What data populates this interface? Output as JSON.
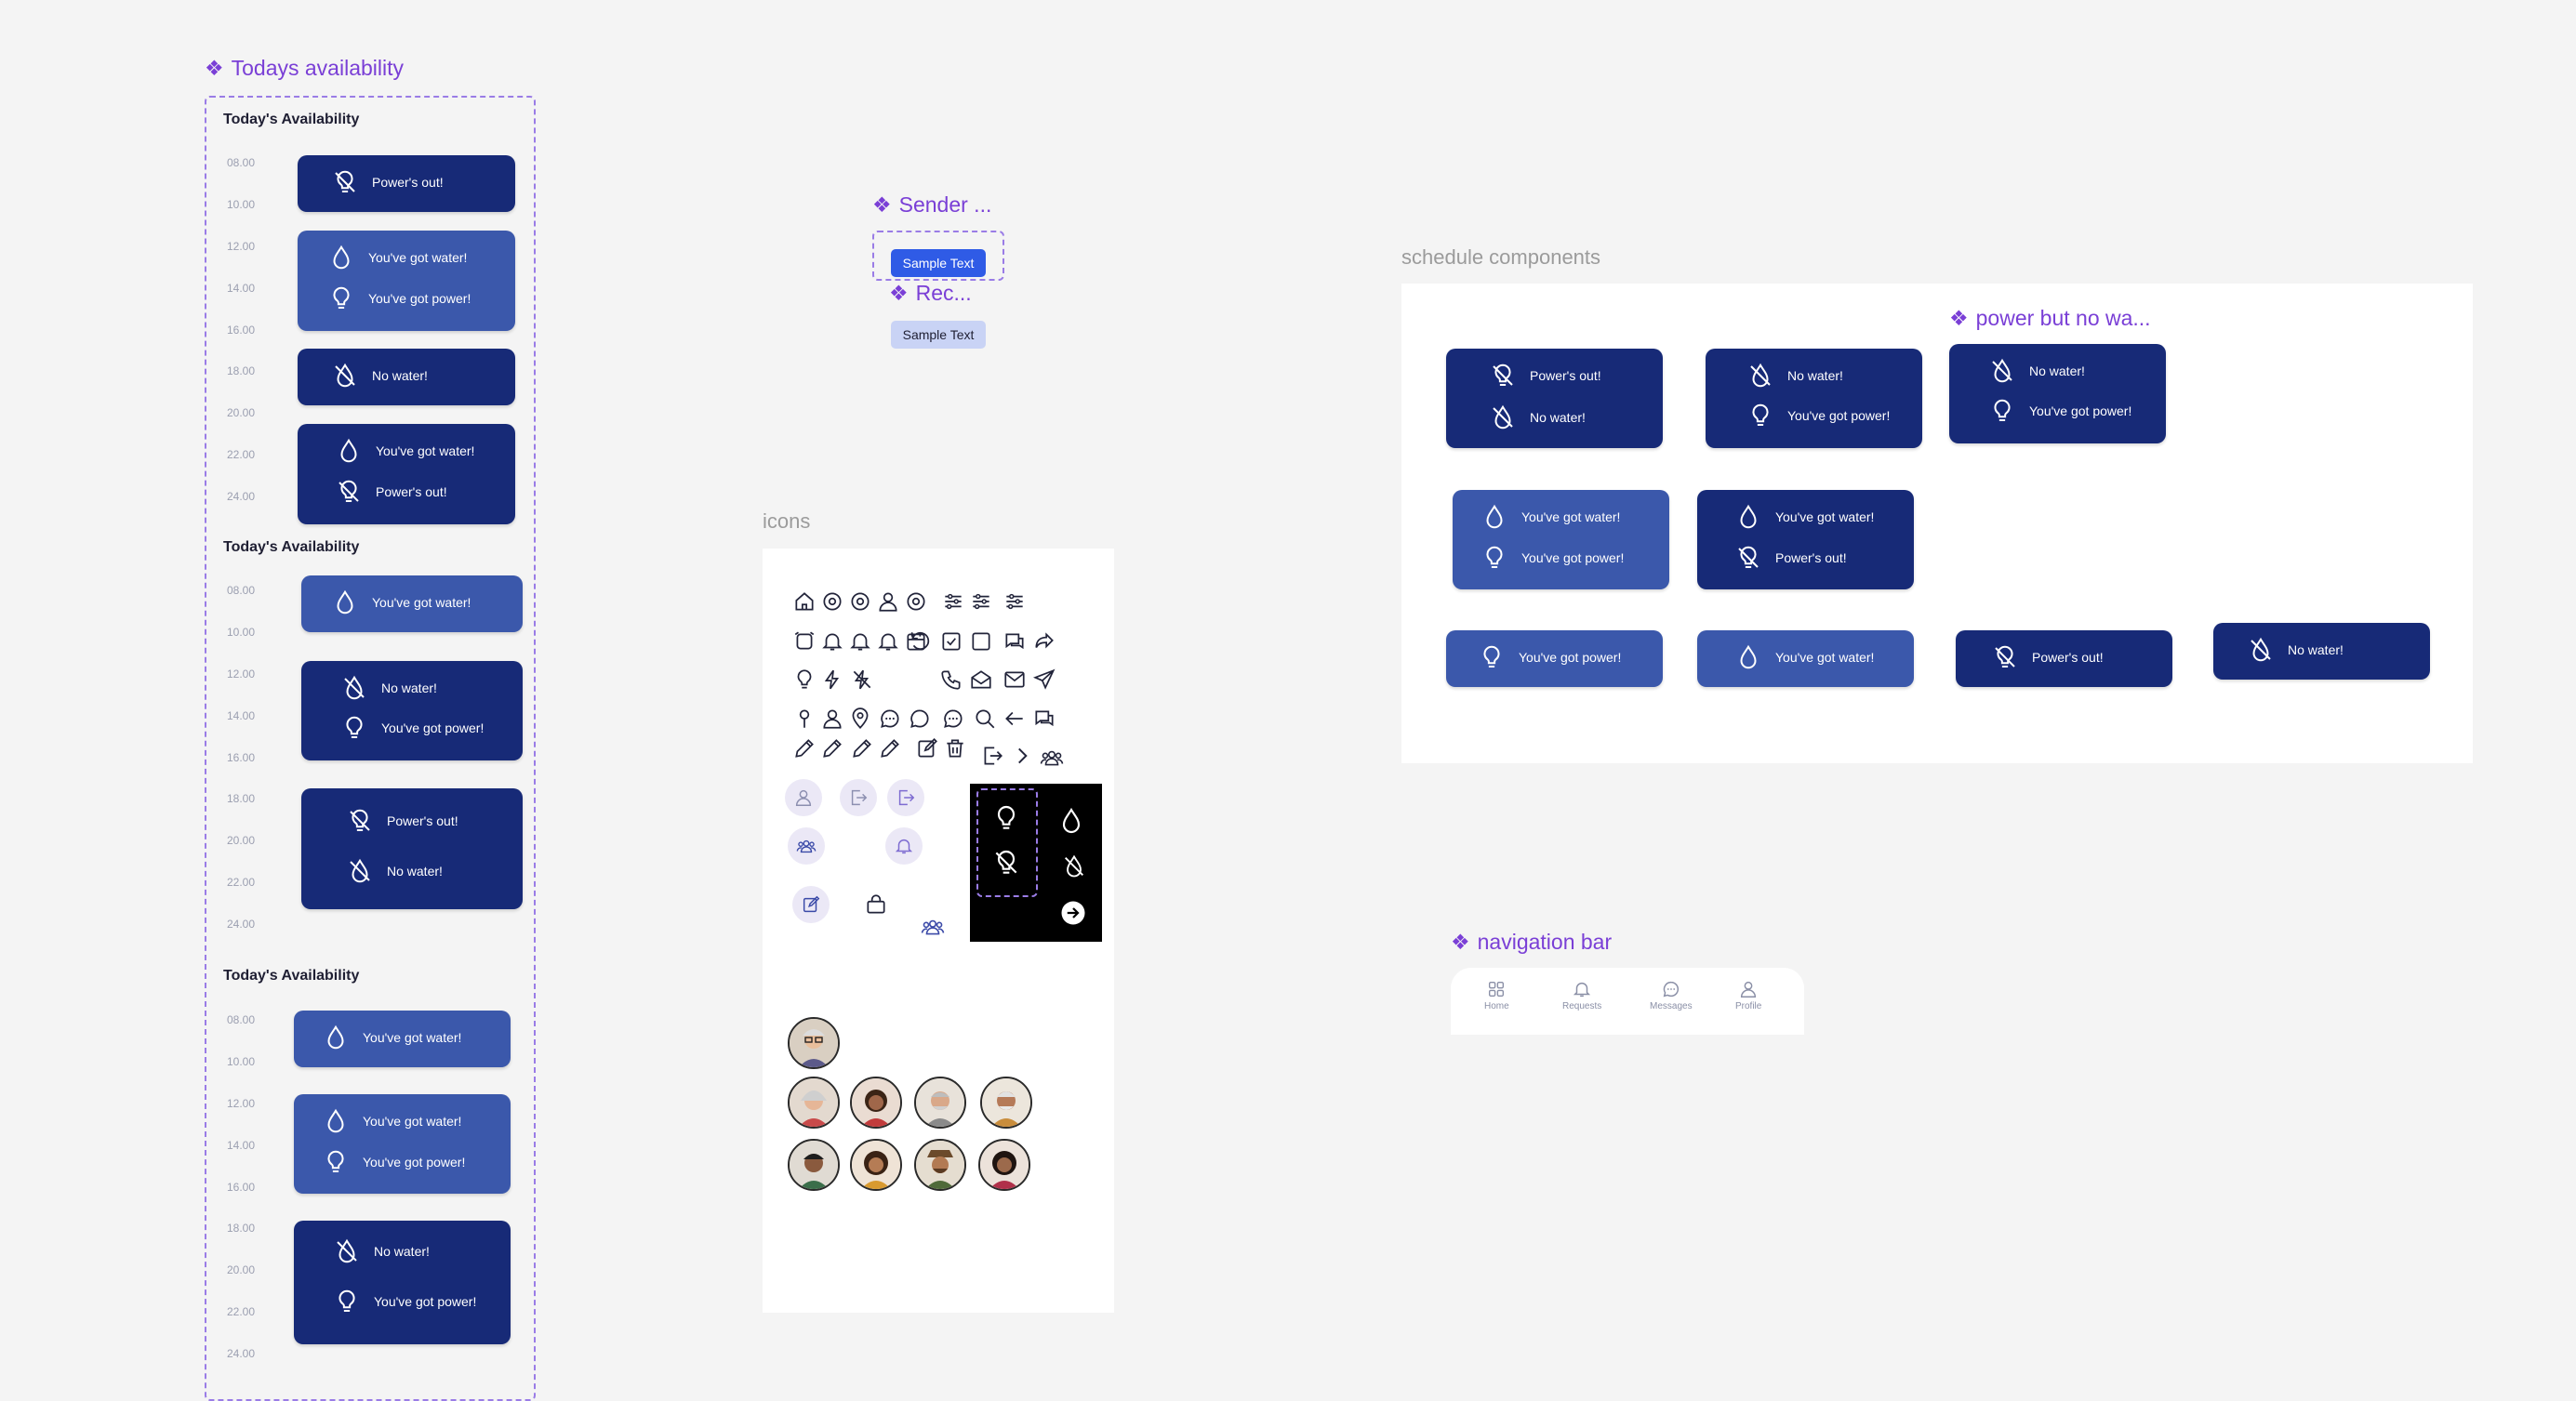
{
  "labels": {
    "todays_availability": "Todays availability",
    "sender": "Sender ...",
    "receiver": "Rec...",
    "schedule_components": "schedule components",
    "power_no_water": "power but no wa...",
    "icons": "icons",
    "navigation_bar": "navigation bar"
  },
  "availability": {
    "title": "Today's Availability",
    "hours": [
      "08.00",
      "10.00",
      "12.00",
      "14.00",
      "16.00",
      "18.00",
      "20.00",
      "22.00",
      "24.00"
    ]
  },
  "status": {
    "power_out": "Power's out!",
    "water_yes": "You've got water!",
    "power_yes": "You've got power!",
    "water_no": "No water!"
  },
  "chat": {
    "sender_text": "Sample Text",
    "receiver_text": "Sample Text"
  },
  "nav": {
    "home": "Home",
    "requests": "Requests",
    "messages": "Messages",
    "profile": "Profile"
  },
  "colors": {
    "dark_card": "#172a77",
    "light_card": "#3b58ab",
    "component_label": "#7a3fd6",
    "sender_bubble": "#2f5be6",
    "receiver_bubble": "#c9d3f5"
  }
}
